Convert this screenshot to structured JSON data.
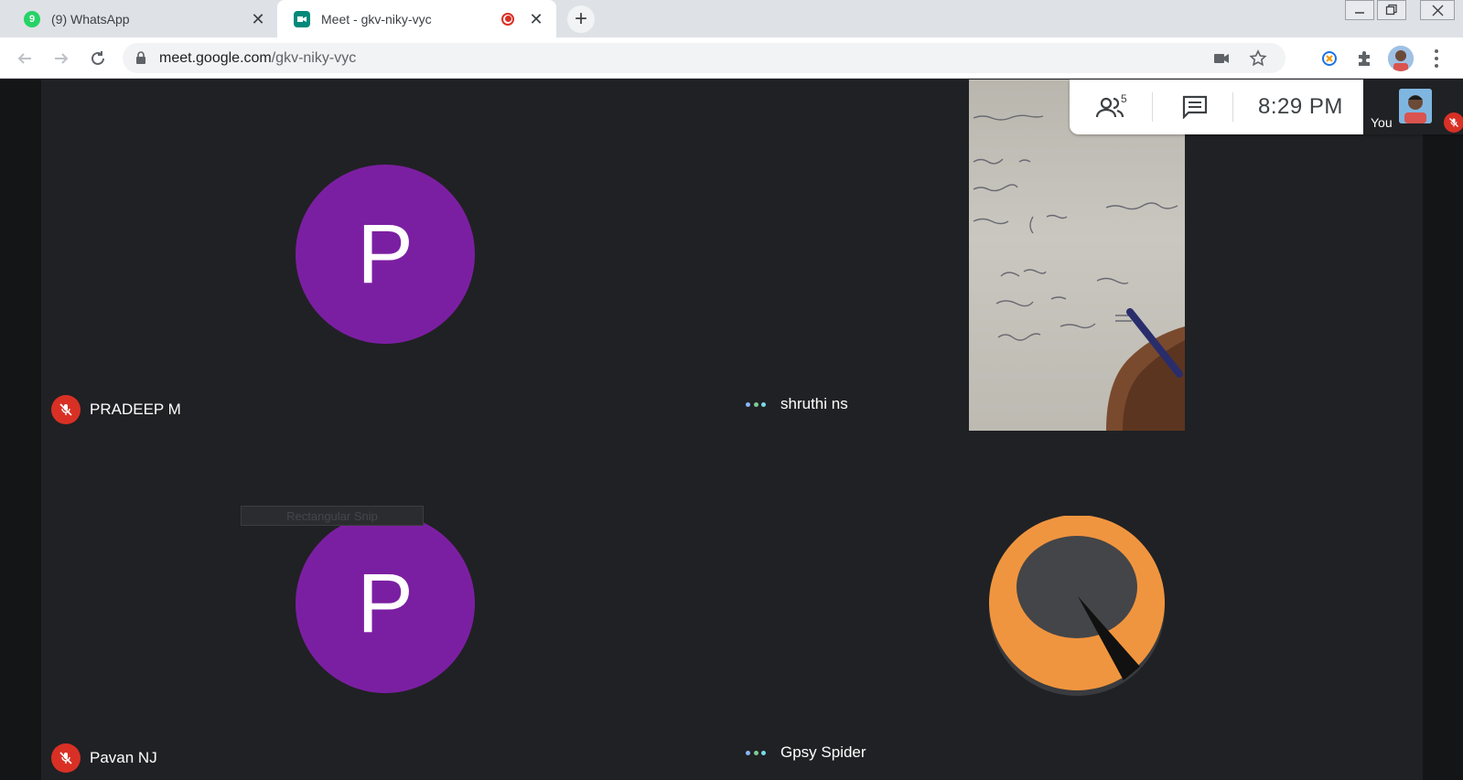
{
  "browser": {
    "tabs": [
      {
        "title": "(9) WhatsApp",
        "favicon_badge": "9",
        "favicon_color": "#25d366"
      },
      {
        "title": "Meet - gkv-niky-vyc",
        "favicon_color": "#00897b",
        "recording": true
      }
    ],
    "url": {
      "host": "meet.google.com",
      "path": "/gkv-niky-vyc"
    }
  },
  "meet": {
    "participants_count": "5",
    "time": "8:29 PM",
    "self_label": "You",
    "tiles": [
      {
        "name": "PRADEEP M",
        "initial": "P",
        "muted": true,
        "avatar_color": "#7b1fa2"
      },
      {
        "name": "shruthi ns",
        "muted": false,
        "video": true
      },
      {
        "name": "Pavan NJ",
        "initial": "P",
        "muted": true,
        "avatar_color": "#7b1fa2"
      },
      {
        "name": "Gpsy Spider",
        "muted": false,
        "avatar_color": "#f0953f"
      }
    ],
    "overlay_label": "Rectangular Snip"
  }
}
